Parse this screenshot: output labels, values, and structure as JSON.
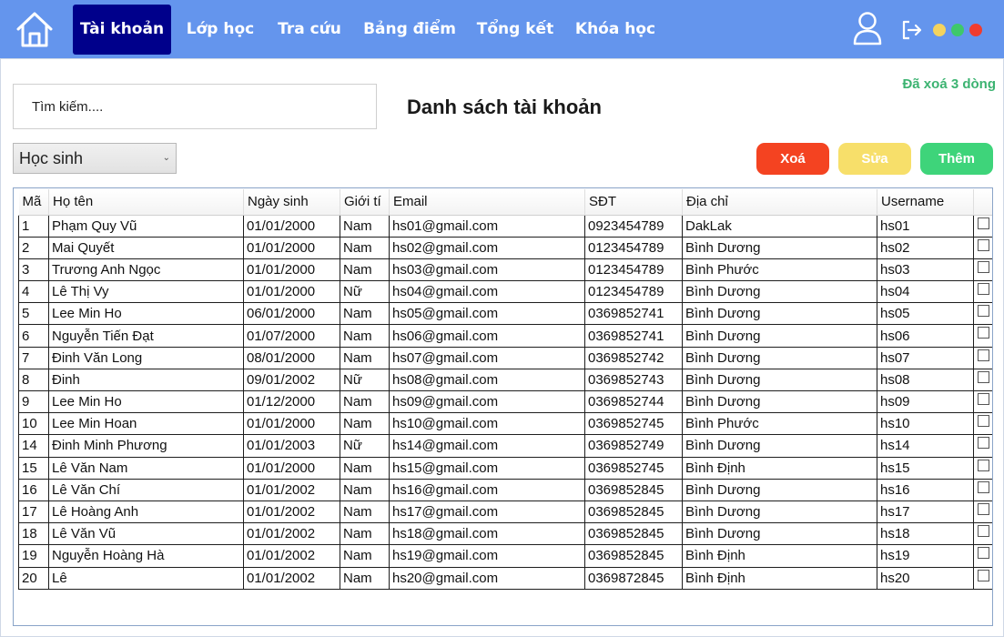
{
  "nav": {
    "home_icon": "home-icon",
    "items": [
      "Tài khoản",
      "Lớp học",
      "Tra cứu",
      "Bảng điểm",
      "Tổng kết",
      "Khóa học"
    ],
    "active": 0,
    "user_icon": "user-icon",
    "logout_icon": "logout-icon",
    "window_dots": [
      "#f4d35e",
      "#3ec86b",
      "#f03c2e"
    ],
    "bar_color": "#6495ed",
    "active_color": "#00008b"
  },
  "search": {
    "placeholder": "Tìm kiếm...."
  },
  "page": {
    "title": "Danh sách tài khoản",
    "status": "Đã xoá 3 dòng"
  },
  "role_select": {
    "value": "Học sinh"
  },
  "actions": {
    "delete": {
      "label": "Xoá",
      "color": "#f44321"
    },
    "edit": {
      "label": "Sửa",
      "color": "#f7df6a"
    },
    "add": {
      "label": "Thêm",
      "color": "#3ed47a"
    }
  },
  "table": {
    "headers": [
      "Mã",
      "Họ tên",
      "Ngày sinh",
      "Giới tí",
      "Email",
      "SĐT",
      "Địa chỉ",
      "Username",
      ""
    ],
    "rows": [
      [
        "1",
        "Phạm Quy Vũ",
        "01/01/2000",
        "Nam",
        "hs01@gmail.com",
        "0923454789",
        "DakLak",
        "hs01"
      ],
      [
        "2",
        "Mai Quyết",
        "01/01/2000",
        "Nam",
        "hs02@gmail.com",
        "0123454789",
        "Bình Dương",
        "hs02"
      ],
      [
        "3",
        "Trương Anh Ngọc",
        "01/01/2000",
        "Nam",
        "hs03@gmail.com",
        "0123454789",
        "Bình Phước",
        "hs03"
      ],
      [
        "4",
        "Lê Thị Vy",
        "01/01/2000",
        "Nữ",
        "hs04@gmail.com",
        "0123454789",
        "Bình Dương",
        "hs04"
      ],
      [
        "5",
        "Lee Min Ho",
        "06/01/2000",
        "Nam",
        "hs05@gmail.com",
        "0369852741",
        "Bình Dương",
        "hs05"
      ],
      [
        "6",
        "Nguyễn Tiến Đạt",
        "01/07/2000",
        "Nam",
        "hs06@gmail.com",
        "0369852741",
        "Bình Dương",
        "hs06"
      ],
      [
        "7",
        "Đinh Văn Long",
        "08/01/2000",
        "Nam",
        "hs07@gmail.com",
        "0369852742",
        "Bình Dương",
        "hs07"
      ],
      [
        "8",
        "Đinh",
        "09/01/2002",
        "Nữ",
        "hs08@gmail.com",
        "0369852743",
        "Bình Dương",
        "hs08"
      ],
      [
        "9",
        "Lee Min Ho",
        "01/12/2000",
        "Nam",
        "hs09@gmail.com",
        "0369852744",
        "Bình Dương",
        "hs09"
      ],
      [
        "10",
        "Lee Min Hoan",
        "01/01/2000",
        "Nam",
        "hs10@gmail.com",
        "0369852745",
        "Bình Phước",
        "hs10"
      ],
      [
        "14",
        "Đinh Minh Phương",
        "01/01/2003",
        "Nữ",
        "hs14@gmail.com",
        "0369852749",
        "Bình Dương",
        "hs14"
      ],
      [
        "15",
        "Lê Văn Nam",
        "01/01/2000",
        "Nam",
        "hs15@gmail.com",
        "0369852745",
        "Bình Định",
        "hs15"
      ],
      [
        "16",
        "Lê Văn Chí",
        "01/01/2002",
        "Nam",
        "hs16@gmail.com",
        "0369852845",
        "Bình Dương",
        "hs16"
      ],
      [
        "17",
        "Lê Hoàng Anh",
        "01/01/2002",
        "Nam",
        "hs17@gmail.com",
        "0369852845",
        "Bình Dương",
        "hs17"
      ],
      [
        "18",
        "Lê Văn Vũ",
        "01/01/2002",
        "Nam",
        "hs18@gmail.com",
        "0369852845",
        "Bình Dương",
        "hs18"
      ],
      [
        "19",
        "Nguyễn Hoàng Hà",
        "01/01/2002",
        "Nam",
        "hs19@gmail.com",
        "0369852845",
        "Bình Định",
        "hs19"
      ],
      [
        "20",
        "Lê",
        "01/01/2002",
        "Nam",
        "hs20@gmail.com",
        "0369872845",
        "Bình Định",
        "hs20"
      ]
    ]
  }
}
